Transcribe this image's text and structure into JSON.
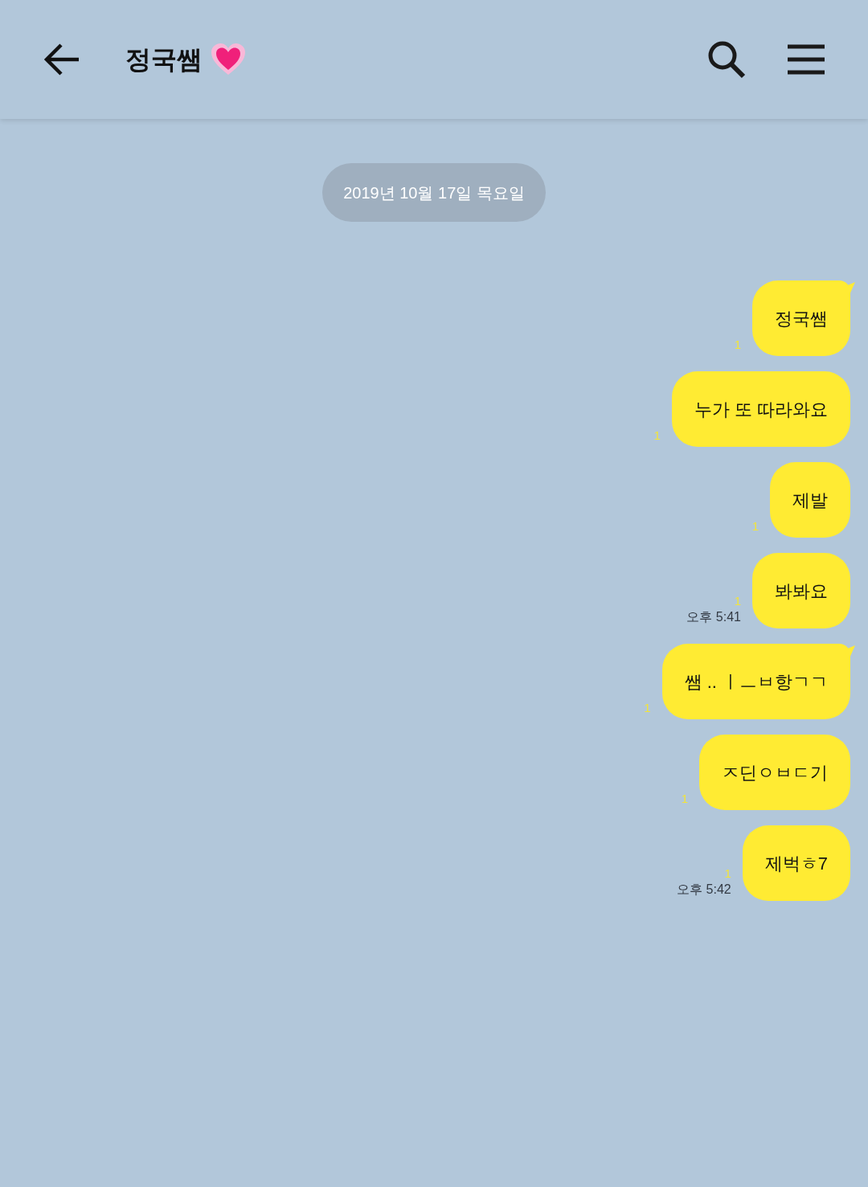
{
  "header": {
    "title": "정국쌤"
  },
  "date_divider": "2019년 10월 17일 목요일",
  "messages": [
    {
      "text": "정국쌤",
      "unread": "1",
      "tail": true
    },
    {
      "text": "누가 또 따라와요",
      "unread": "1",
      "tail": false
    },
    {
      "text": "제발",
      "unread": "1",
      "tail": false
    },
    {
      "text": "봐봐요",
      "unread": "1",
      "tail": false,
      "time": "오후 5:41"
    },
    {
      "text": "쌤 .. ㅣㅡㅂ항ㄱㄱ",
      "unread": "1",
      "tail": true
    },
    {
      "text": "ㅈ딘ㅇㅂㄷ기",
      "unread": "1",
      "tail": false
    },
    {
      "text": "제벅ㅎ7",
      "unread": "1",
      "tail": false,
      "time": "오후 5:42"
    }
  ]
}
